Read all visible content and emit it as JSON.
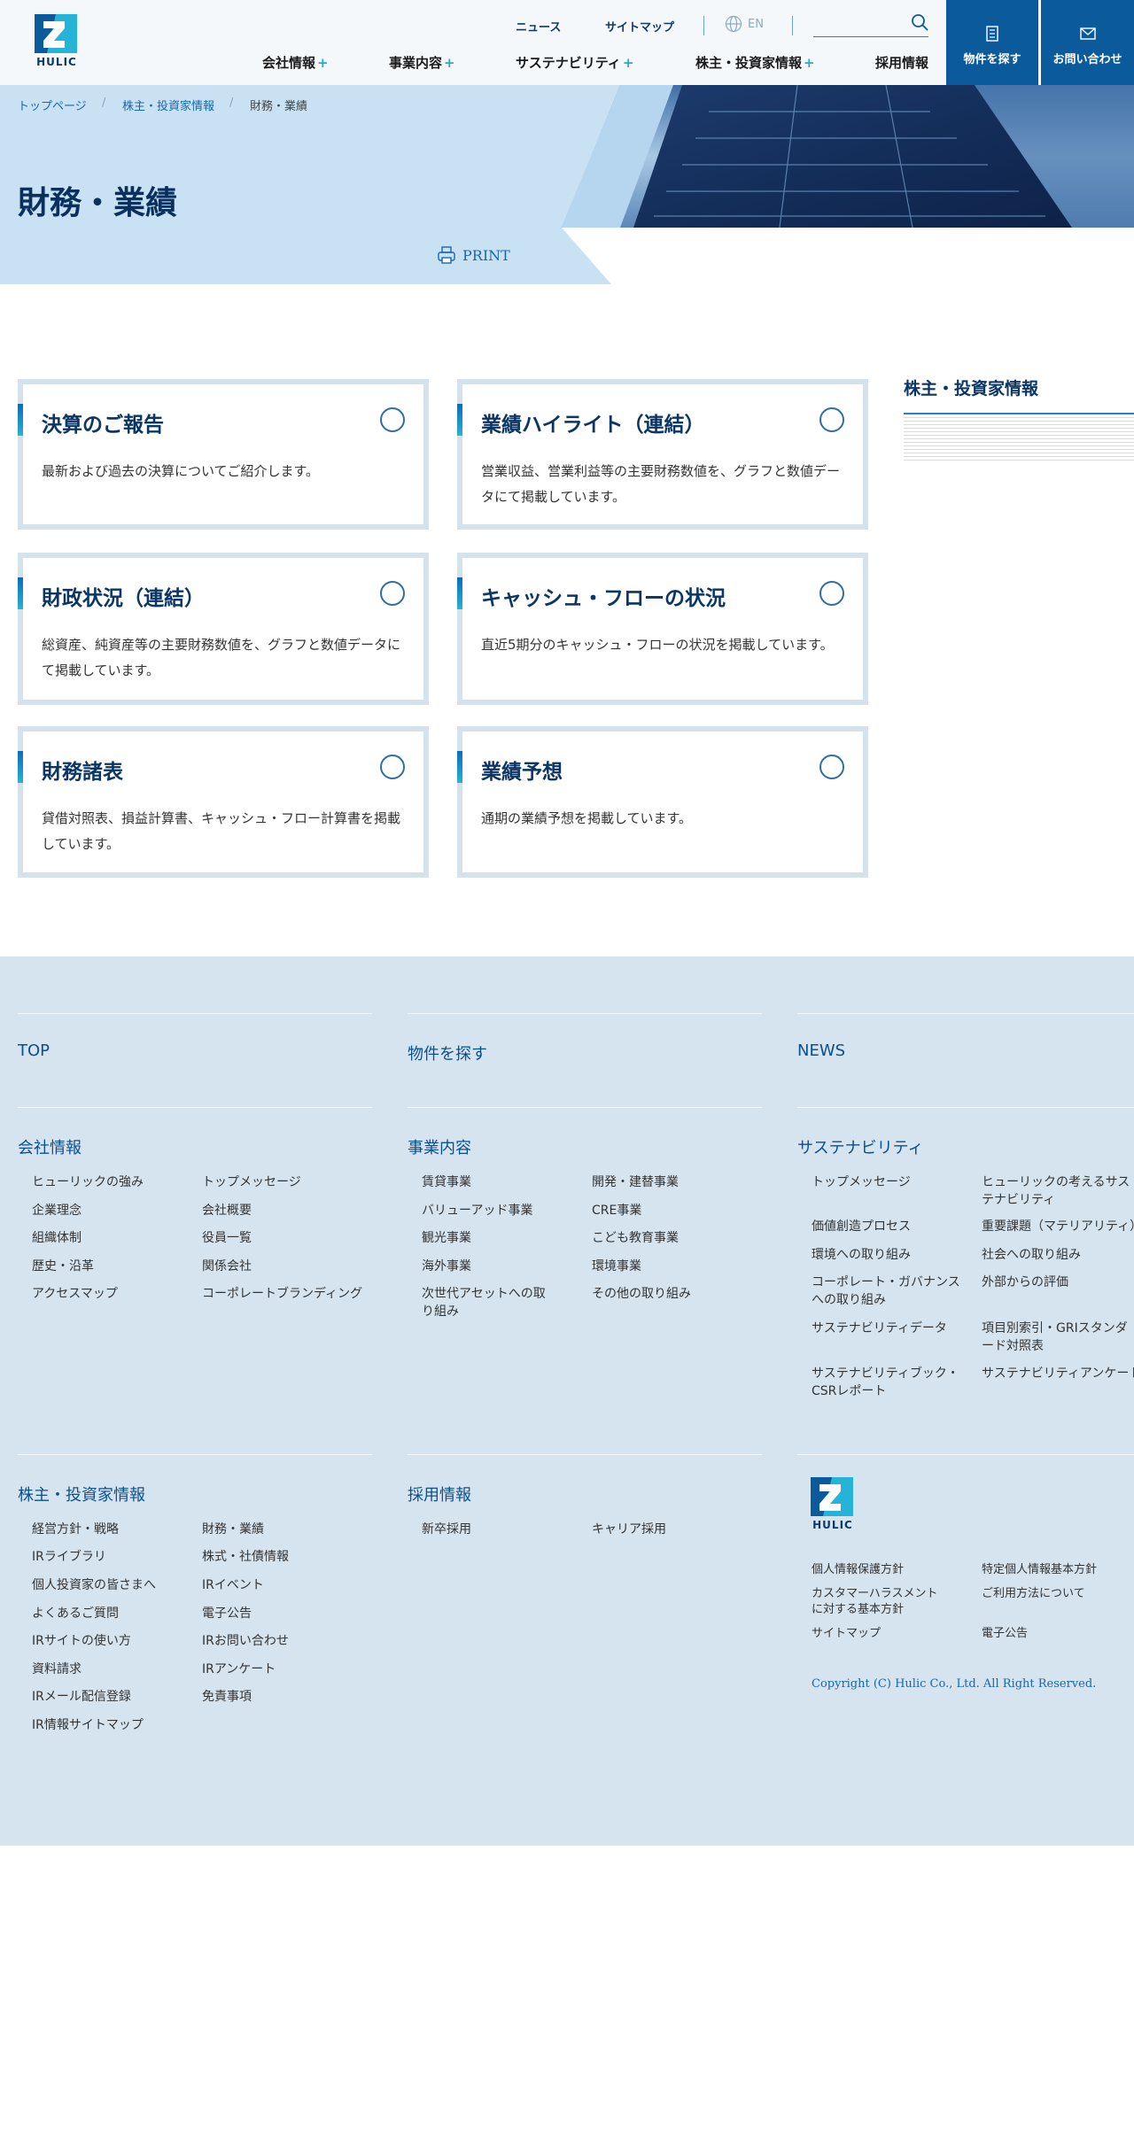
{
  "header": {
    "logo_text": "HULIC",
    "utility": {
      "news": "ニュース",
      "sitemap": "サイトマップ",
      "lang": "EN"
    },
    "nav": [
      {
        "label": "会社情報",
        "plus": "+"
      },
      {
        "label": "事業内容",
        "plus": "+"
      },
      {
        "label": "サステナビリティ",
        "plus": "+"
      },
      {
        "label": "株主・投資家情報",
        "plus": "+"
      },
      {
        "label": "採用情報",
        "plus": ""
      }
    ],
    "buttons": {
      "property": "物件を探す",
      "contact": "お問い合わせ"
    }
  },
  "hero": {
    "breadcrumb": {
      "top": "トップページ",
      "sep": "/",
      "ir": "株主・投資家情報",
      "current": "財務・業績"
    },
    "title": "財務・業績",
    "print": "PRINT"
  },
  "cards": [
    {
      "title": "決算のご報告",
      "desc": "最新および過去の決算についてご紹介します。"
    },
    {
      "title": "業績ハイライト（連結）",
      "desc": "営業収益、営業利益等の主要財務数値を、グラフと数値データにて掲載しています。"
    },
    {
      "title": "財政状況（連結）",
      "desc": "総資産、純資産等の主要財務数値を、グラフと数値データにて掲載しています。"
    },
    {
      "title": "キャッシュ・フローの状況",
      "desc": "直近5期分のキャッシュ・フローの状況を掲載しています。"
    },
    {
      "title": "財務諸表",
      "desc": "貸借対照表、損益計算書、キャッシュ・フロー計算書を掲載しています。"
    },
    {
      "title": "業績予想",
      "desc": "通期の業績予想を掲載しています。"
    }
  ],
  "sidebar": {
    "title": "株主・投資家情報"
  },
  "footer": {
    "top": "TOP",
    "property": "物件を探す",
    "news": "NEWS",
    "company": {
      "title": "会社情報",
      "links": [
        "ヒューリックの強み",
        "トップメッセージ",
        "企業理念",
        "会社概要",
        "組織体制",
        "役員一覧",
        "歴史・沿革",
        "関係会社",
        "アクセスマップ",
        "コーポレートブランディング"
      ]
    },
    "business": {
      "title": "事業内容",
      "links": [
        "賃貸事業",
        "開発・建替事業",
        "バリューアッド事業",
        "CRE事業",
        "観光事業",
        "こども教育事業",
        "海外事業",
        "環境事業",
        "次世代アセットへの取り組み",
        "その他の取り組み"
      ]
    },
    "sustainability": {
      "title": "サステナビリティ",
      "links": [
        "トップメッセージ",
        "ヒューリックの考えるサステナビリティ",
        "価値創造プロセス",
        "重要課題（マテリアリティ）",
        "環境への取り組み",
        "社会への取り組み",
        "コーポレート・ガバナンスへの取り組み",
        "外部からの評価",
        "サステナビリティデータ",
        "項目別索引・GRIスタンダード対照表",
        "サステナビリティブック・CSRレポート",
        "サステナビリティアンケート"
      ]
    },
    "ir": {
      "title": "株主・投資家情報",
      "links": [
        "経営方針・戦略",
        "財務・業績",
        "IRライブラリ",
        "株式・社債情報",
        "個人投資家の皆さまへ",
        "IRイベント",
        "よくあるご質問",
        "電子公告",
        "IRサイトの使い方",
        "IRお問い合わせ",
        "資料請求",
        "IRアンケート",
        "IRメール配信登録",
        "免責事項",
        "IR情報サイトマップ"
      ]
    },
    "recruit": {
      "title": "採用情報",
      "links": [
        "新卒採用",
        "キャリア採用"
      ]
    },
    "legal": [
      "個人情報保護方針",
      "特定個人情報基本方針",
      "カスタマーハラスメントに対する基本方針",
      "ご利用方法について",
      "サイトマップ",
      "電子公告"
    ],
    "copyright": "Copyright (C) Hulic Co., Ltd. All Right Reserved."
  }
}
